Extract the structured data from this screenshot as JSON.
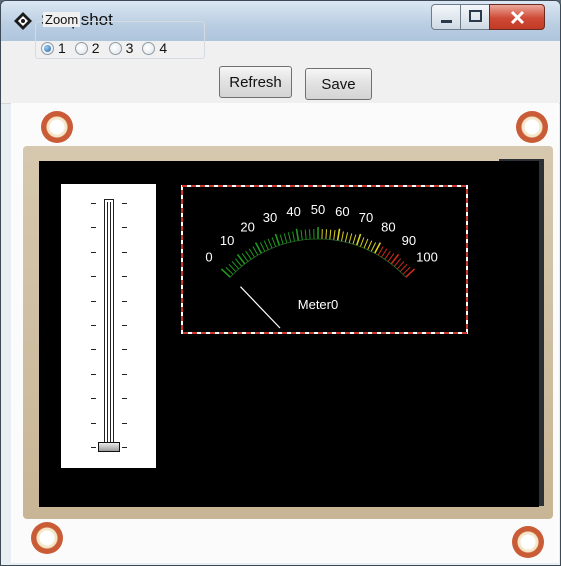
{
  "window": {
    "title": "Snapshot",
    "icon": "diamond-app-icon"
  },
  "toolbar": {
    "zoom_label": "Zoom",
    "zoom_options": [
      "1",
      "2",
      "3",
      "4"
    ],
    "zoom_selected": "1",
    "refresh_label": "Refresh",
    "save_label": "Save"
  },
  "meter": {
    "label": "Meter0",
    "scale_labels": [
      "0",
      "10",
      "20",
      "30",
      "40",
      "50",
      "60",
      "70",
      "80",
      "90",
      "100"
    ],
    "min": 0,
    "max": 100,
    "value": 0,
    "zone_colors": {
      "low": "#1f9a1f",
      "mid": "#d8d220",
      "high": "#cc2a1a"
    },
    "frame_color": "#c83a30"
  },
  "slider": {
    "value": 0,
    "min": 0,
    "max": 100,
    "tick_count": 11
  },
  "colors": {
    "pcb": "#d6c8ae",
    "screen": "#000000",
    "mount_hole": "#c95c36"
  }
}
